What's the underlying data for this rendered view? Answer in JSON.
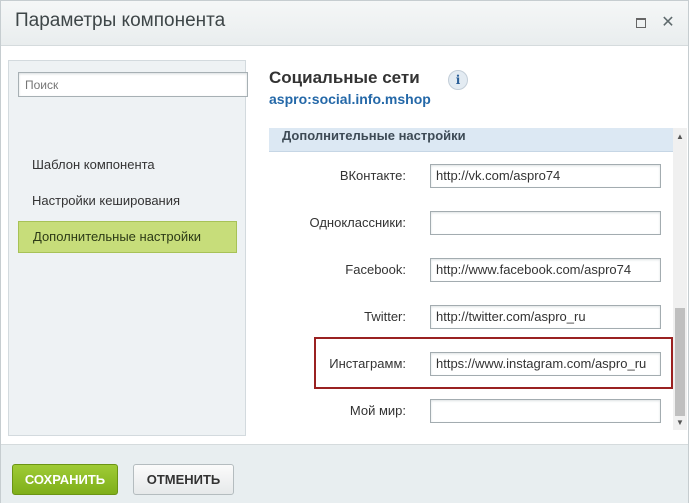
{
  "window": {
    "title": "Параметры компонента",
    "maximize_icon": "maximize-icon",
    "close_icon": "close-icon",
    "close_glyph": "✕"
  },
  "sidebar": {
    "search_placeholder": "Поиск",
    "items": [
      {
        "label": "Шаблон компонента",
        "active": false
      },
      {
        "label": "Настройки кеширования",
        "active": false
      },
      {
        "label": "Дополнительные настройки",
        "active": true
      }
    ]
  },
  "main": {
    "title": "Социальные сети",
    "info_glyph": "i",
    "component_code": "aspro:social.info.mshop",
    "group_title": "Дополнительные настройки",
    "params": [
      {
        "label": "ВКонтакте:",
        "value": "http://vk.com/aspro74"
      },
      {
        "label": "Одноклассники:",
        "value": ""
      },
      {
        "label": "Facebook:",
        "value": "http://www.facebook.com/aspro74"
      },
      {
        "label": "Twitter:",
        "value": "http://twitter.com/aspro_ru"
      },
      {
        "label": "Инстаграмм:",
        "value": "https://www.instagram.com/aspro_ru"
      },
      {
        "label": "Мой мир:",
        "value": ""
      }
    ],
    "highlight_color": "#9a2121"
  },
  "footer": {
    "save_label": "СОХРАНИТЬ",
    "cancel_label": "ОТМЕНИТЬ"
  },
  "colors": {
    "accent_green": "#8dbd25",
    "link_blue": "#2468a8",
    "active_item": "#c7dd7a"
  }
}
